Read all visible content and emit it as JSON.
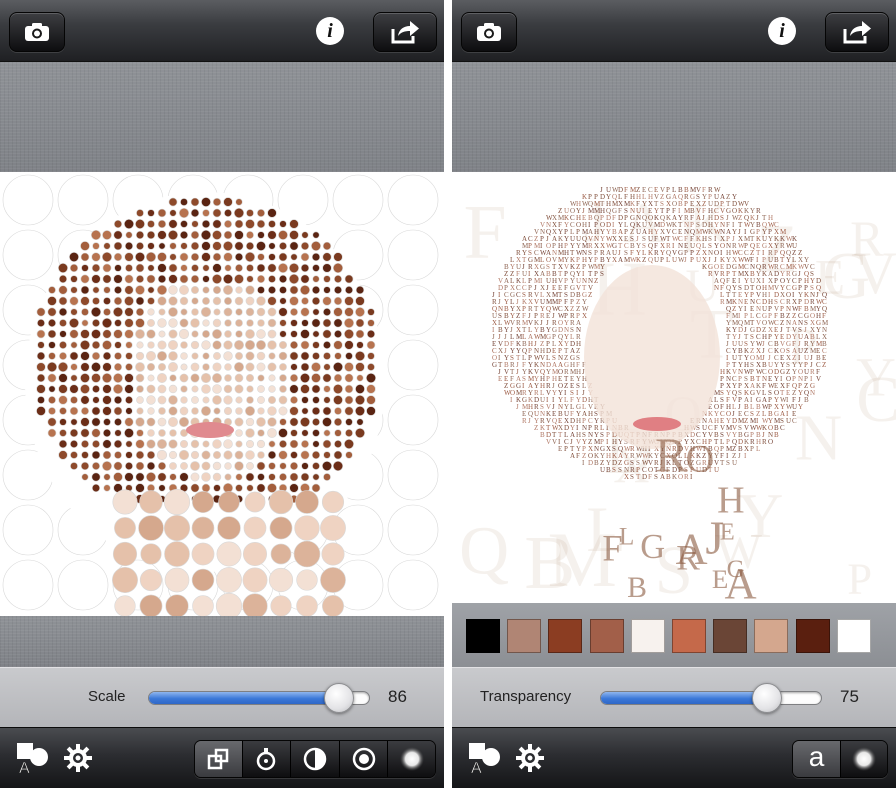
{
  "left_screen": {
    "topbar": {
      "camera_icon": "camera-icon",
      "info_label": "i",
      "share_icon": "share-icon"
    },
    "slider": {
      "label": "Scale",
      "value": "86",
      "fraction": 0.86
    },
    "bottombar": {
      "font_shape_icon": "font-shape-icon",
      "settings_icon": "gear-icon",
      "modes": [
        {
          "name": "square-shape-mode",
          "icon": "squares-icon",
          "active": true
        },
        {
          "name": "timer-shape-mode",
          "icon": "timer-circle-icon",
          "active": false
        },
        {
          "name": "contrast-mode",
          "icon": "half-circle-icon",
          "active": false
        },
        {
          "name": "ring-mode",
          "icon": "target-circle-icon",
          "active": false
        },
        {
          "name": "sphere-mode",
          "icon": "glow-sphere-icon",
          "active": false
        }
      ]
    }
  },
  "right_screen": {
    "topbar": {
      "camera_icon": "camera-icon",
      "info_label": "i",
      "share_icon": "share-icon"
    },
    "swatches": [
      "#000000",
      "#b08574",
      "#8b3d22",
      "#a25f49",
      "#f7f2ee",
      "#c5694a",
      "#6a4536",
      "#d4a78e",
      "#5a1f0f",
      "#ffffff"
    ],
    "slider": {
      "label": "Transparency",
      "value": "75",
      "fraction": 0.75
    },
    "bottombar": {
      "font_shape_icon": "font-shape-icon",
      "settings_icon": "gear-icon",
      "letter_mode_label": "a",
      "sphere_icon": "glow-sphere-icon"
    },
    "art_letters": [
      "H",
      "X",
      "Y",
      "S",
      "D",
      "Q",
      "E",
      "L",
      "P",
      "Z",
      "O",
      "K",
      "J",
      "B",
      "U",
      "G",
      "T",
      "F",
      "Y",
      "P",
      "M",
      "V",
      "I",
      "A",
      "C",
      "W",
      "N",
      "R"
    ]
  },
  "colors": {
    "slider_fill": "#3b78d8",
    "skin": "#dcb39a",
    "hair": "#7a3a1f"
  }
}
